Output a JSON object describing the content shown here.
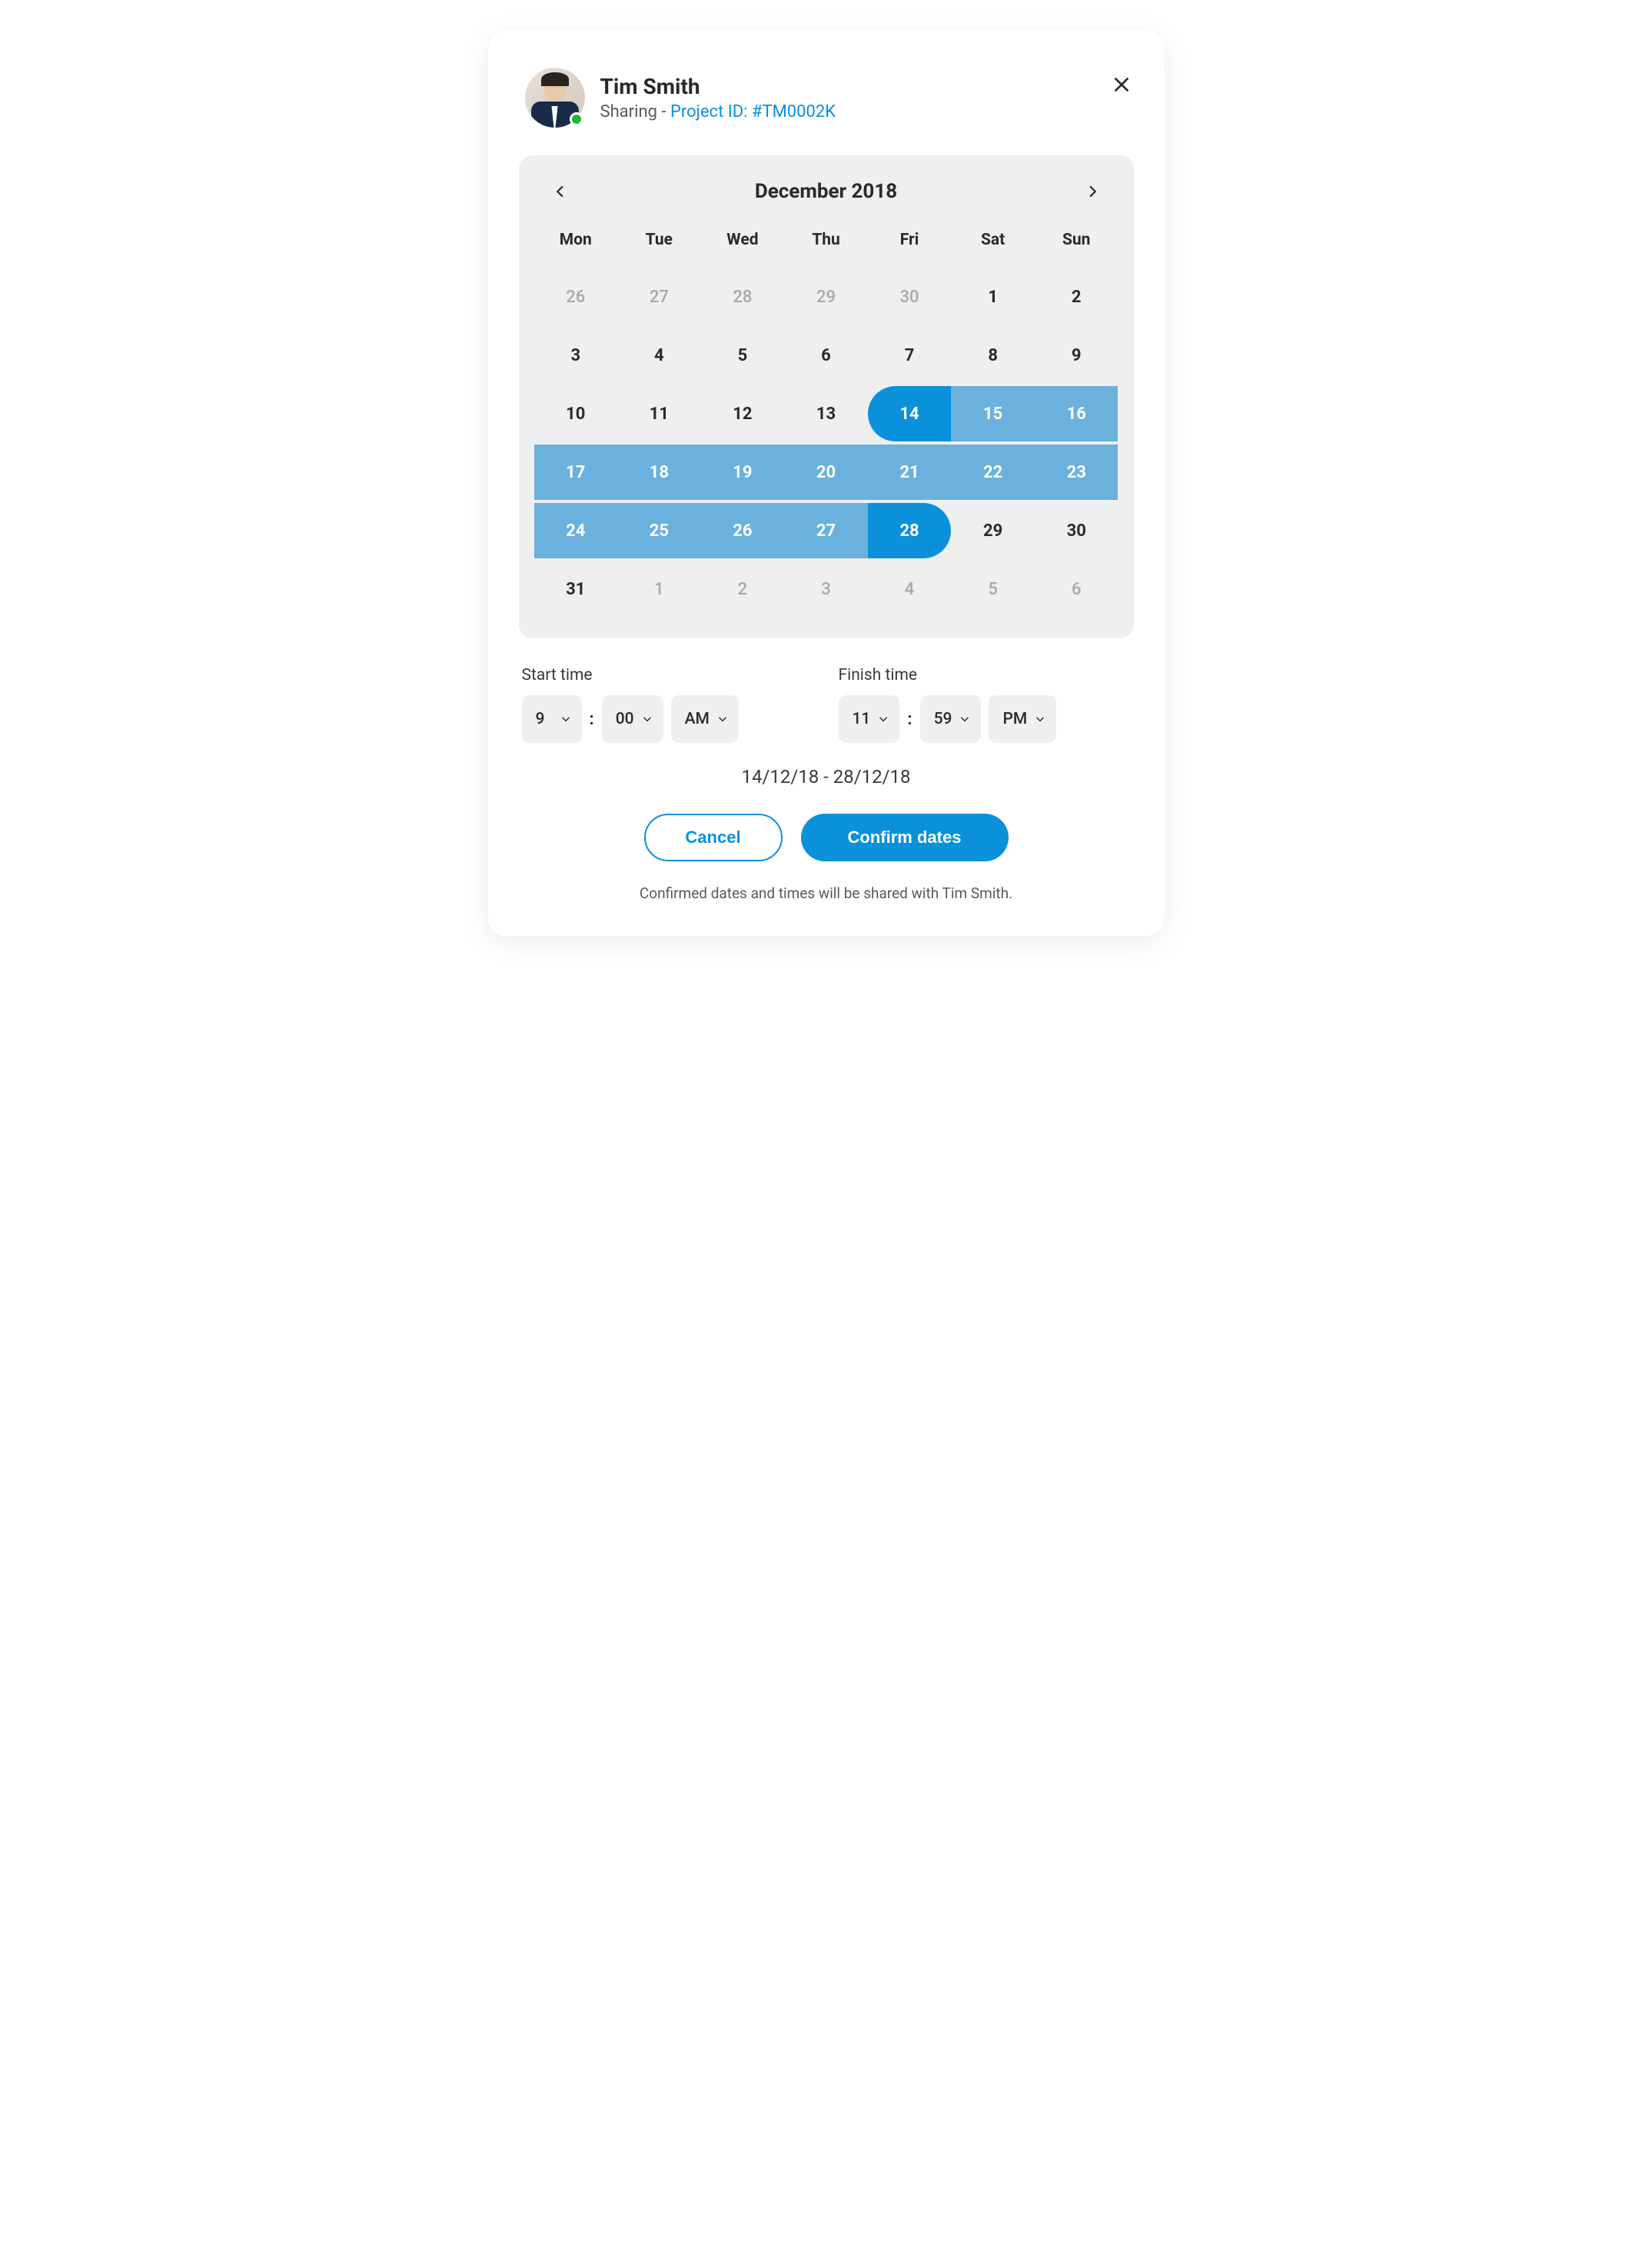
{
  "user": {
    "name": "Tim Smith",
    "status": "online"
  },
  "header": {
    "sharing_prefix": "Sharing - ",
    "project_link": "Project ID: #TM0002K"
  },
  "calendar": {
    "month_label": "December 2018",
    "weekdays": [
      "Mon",
      "Tue",
      "Wed",
      "Thu",
      "Fri",
      "Sat",
      "Sun"
    ],
    "weeks": [
      [
        {
          "n": "26",
          "state": "other"
        },
        {
          "n": "27",
          "state": "other"
        },
        {
          "n": "28",
          "state": "other"
        },
        {
          "n": "29",
          "state": "other"
        },
        {
          "n": "30",
          "state": "other"
        },
        {
          "n": "1",
          "state": "current"
        },
        {
          "n": "2",
          "state": "current"
        }
      ],
      [
        {
          "n": "3",
          "state": "current"
        },
        {
          "n": "4",
          "state": "current"
        },
        {
          "n": "5",
          "state": "current"
        },
        {
          "n": "6",
          "state": "current"
        },
        {
          "n": "7",
          "state": "current"
        },
        {
          "n": "8",
          "state": "current"
        },
        {
          "n": "9",
          "state": "current"
        }
      ],
      [
        {
          "n": "10",
          "state": "current"
        },
        {
          "n": "11",
          "state": "current"
        },
        {
          "n": "12",
          "state": "current"
        },
        {
          "n": "13",
          "state": "current"
        },
        {
          "n": "14",
          "state": "cap-start"
        },
        {
          "n": "15",
          "state": "range"
        },
        {
          "n": "16",
          "state": "range"
        }
      ],
      [
        {
          "n": "17",
          "state": "range"
        },
        {
          "n": "18",
          "state": "range"
        },
        {
          "n": "19",
          "state": "range"
        },
        {
          "n": "20",
          "state": "range"
        },
        {
          "n": "21",
          "state": "range"
        },
        {
          "n": "22",
          "state": "range"
        },
        {
          "n": "23",
          "state": "range"
        }
      ],
      [
        {
          "n": "24",
          "state": "range"
        },
        {
          "n": "25",
          "state": "range"
        },
        {
          "n": "26",
          "state": "range"
        },
        {
          "n": "27",
          "state": "range"
        },
        {
          "n": "28",
          "state": "cap-end"
        },
        {
          "n": "29",
          "state": "current"
        },
        {
          "n": "30",
          "state": "current"
        }
      ],
      [
        {
          "n": "31",
          "state": "current"
        },
        {
          "n": "1",
          "state": "other"
        },
        {
          "n": "2",
          "state": "other"
        },
        {
          "n": "3",
          "state": "other"
        },
        {
          "n": "4",
          "state": "other"
        },
        {
          "n": "5",
          "state": "other"
        },
        {
          "n": "6",
          "state": "other"
        }
      ]
    ]
  },
  "times": {
    "start_label": "Start time",
    "finish_label": "Finish time",
    "start": {
      "hour": "9",
      "minute": "00",
      "period": "AM"
    },
    "finish": {
      "hour": "11",
      "minute": "59",
      "period": "PM"
    }
  },
  "range_display": "14/12/18 - 28/12/18",
  "actions": {
    "cancel": "Cancel",
    "confirm": "Confirm dates"
  },
  "footnote": "Confirmed dates and times will be shared with Tim Smith."
}
